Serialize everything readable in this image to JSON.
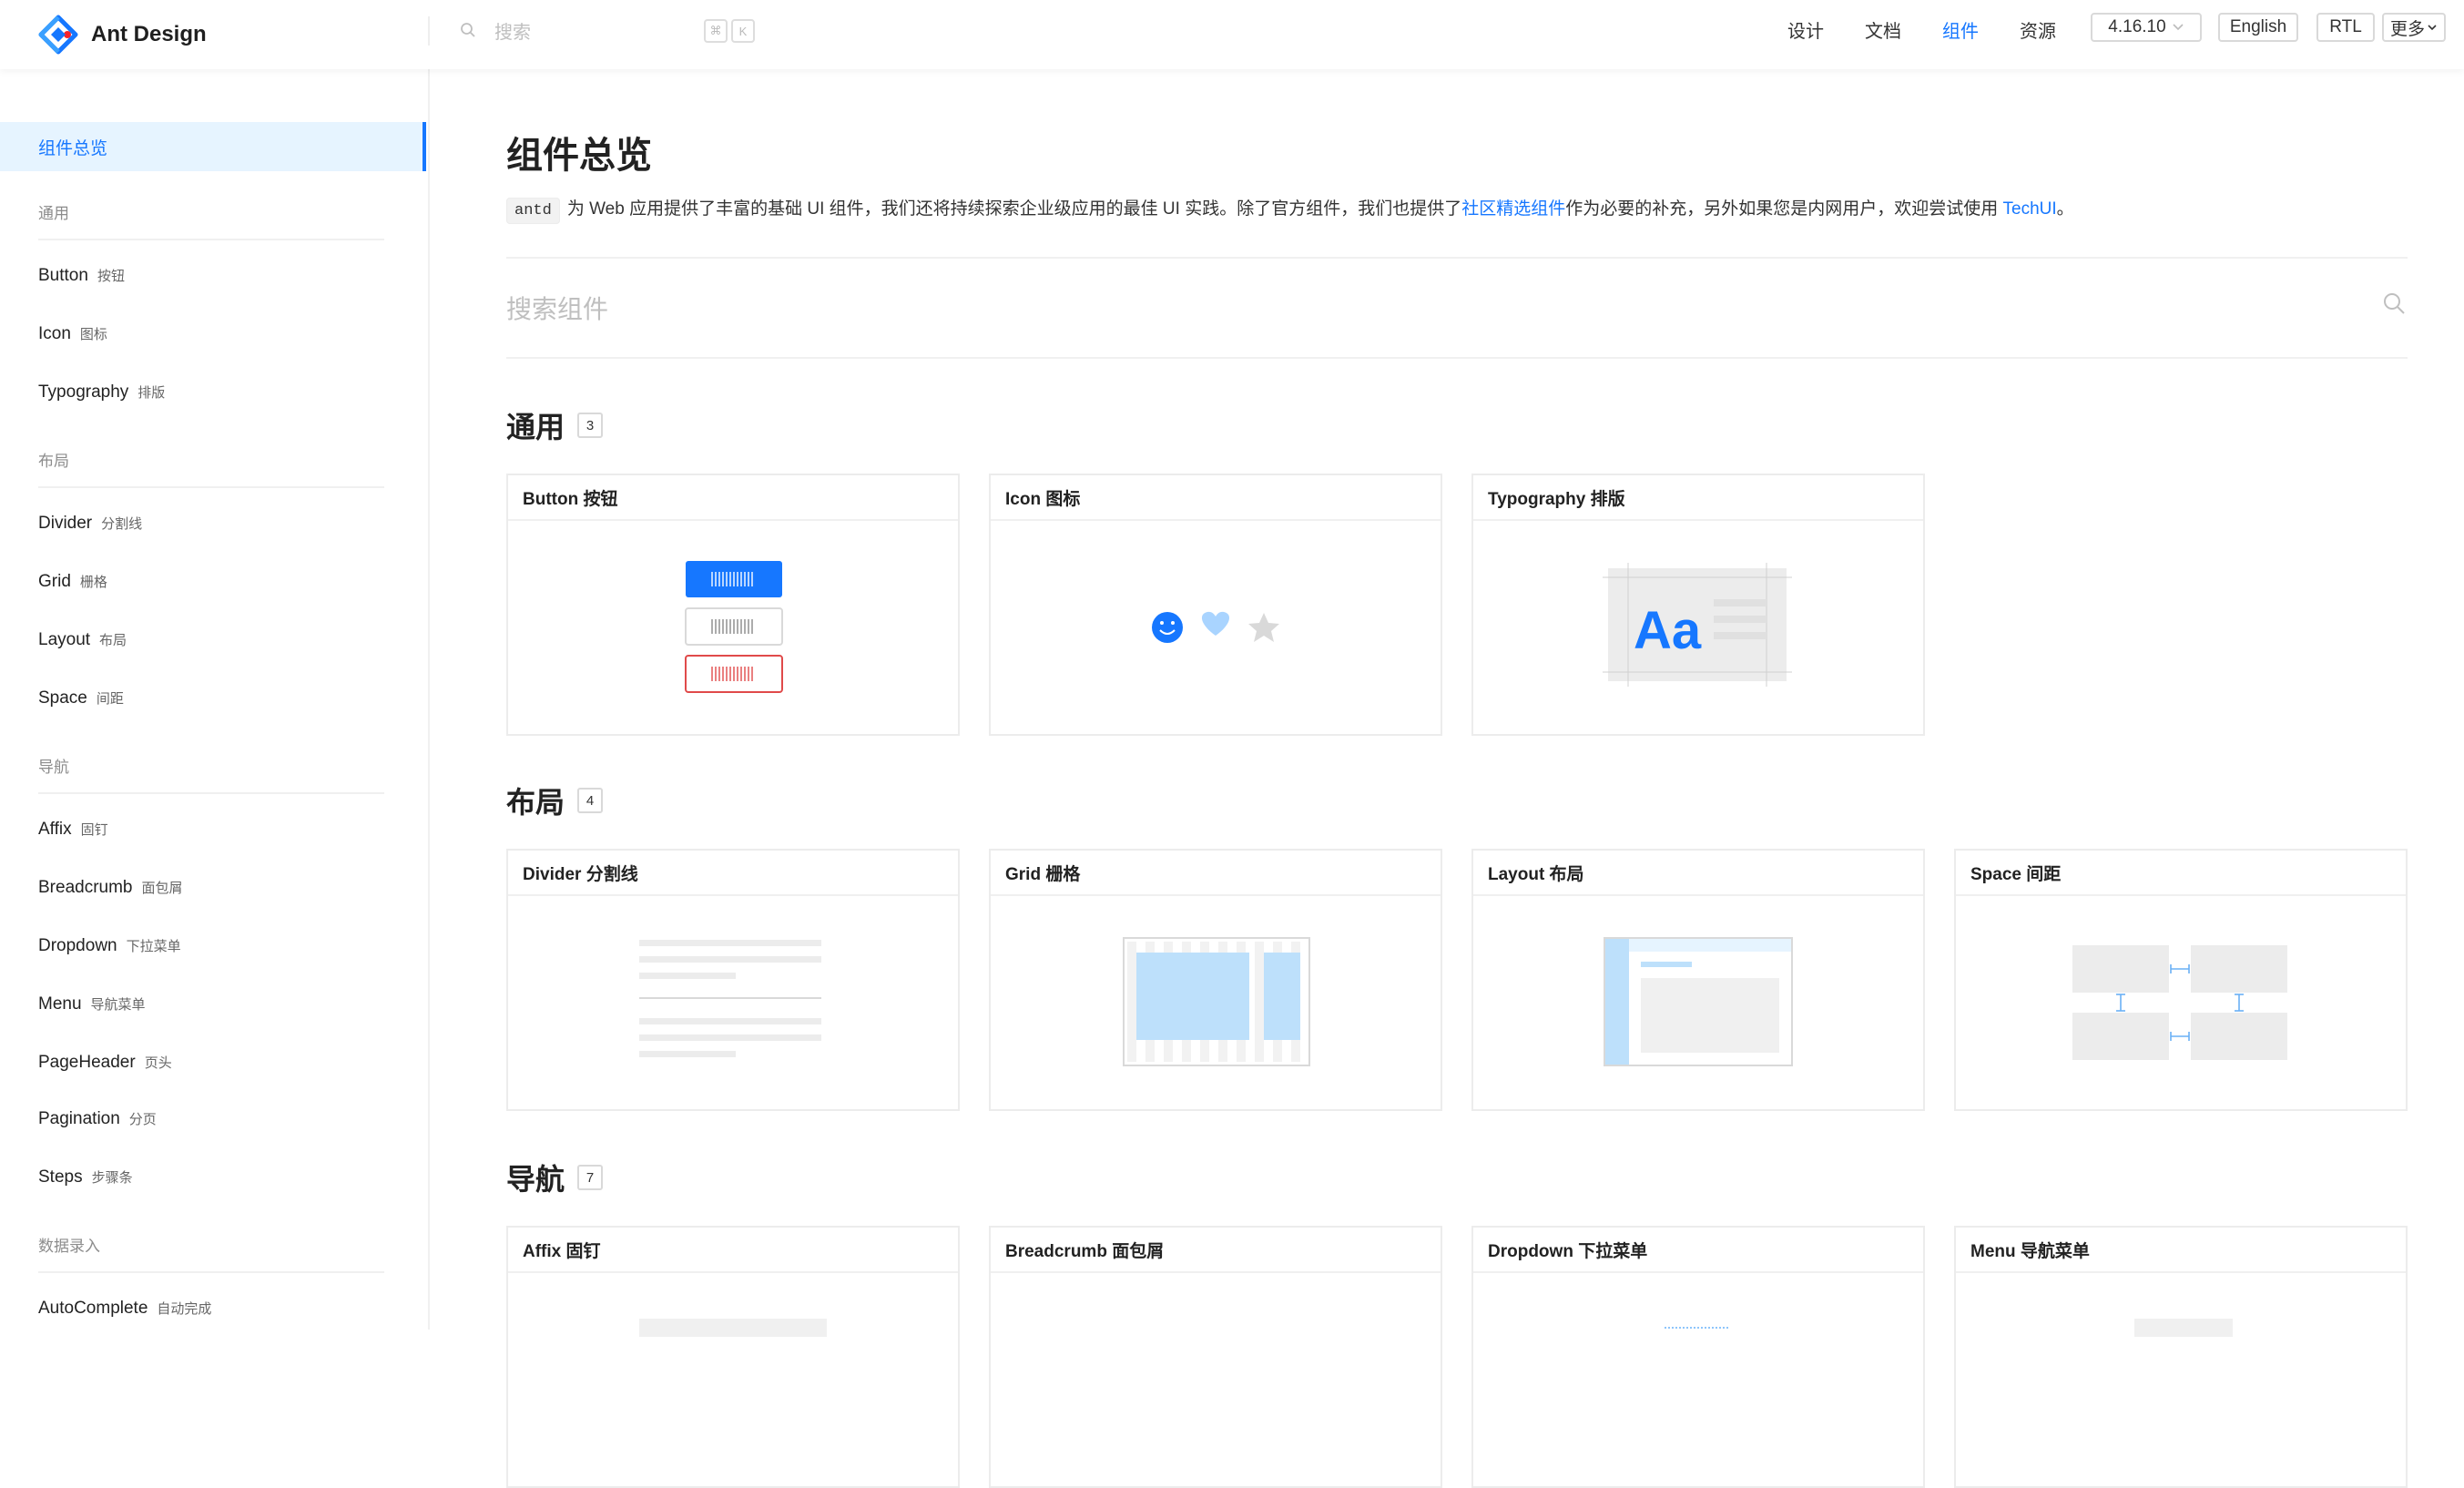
{
  "brand": {
    "name": "Ant Design",
    "logo_icon": "ant-design-logo-icon"
  },
  "header": {
    "search_placeholder": "搜索",
    "shortcut_keys": [
      "⌘",
      "K"
    ],
    "nav": [
      "设计",
      "文档",
      "组件",
      "资源"
    ],
    "active_nav": "组件",
    "version": "4.16.10",
    "lang_button": "English",
    "rtl_button": "RTL",
    "more_button": "更多"
  },
  "sidebar": {
    "active": "组件总览",
    "groups": [
      {
        "title": "通用",
        "items": [
          [
            "Button",
            "按钮"
          ],
          [
            "Icon",
            "图标"
          ],
          [
            "Typography",
            "排版"
          ]
        ]
      },
      {
        "title": "布局",
        "items": [
          [
            "Divider",
            "分割线"
          ],
          [
            "Grid",
            "栅格"
          ],
          [
            "Layout",
            "布局"
          ],
          [
            "Space",
            "间距"
          ]
        ]
      },
      {
        "title": "导航",
        "items": [
          [
            "Affix",
            "固钉"
          ],
          [
            "Breadcrumb",
            "面包屑"
          ],
          [
            "Dropdown",
            "下拉菜单"
          ],
          [
            "Menu",
            "导航菜单"
          ],
          [
            "PageHeader",
            "页头"
          ],
          [
            "Pagination",
            "分页"
          ],
          [
            "Steps",
            "步骤条"
          ]
        ]
      },
      {
        "title": "数据录入",
        "items": [
          [
            "AutoComplete",
            "自动完成"
          ]
        ]
      }
    ]
  },
  "main": {
    "title": "组件总览",
    "intro": {
      "code": "antd",
      "text1": "为 Web 应用提供了丰富的基础 UI 组件，我们还将持续探索企业级应用的最佳 UI 实践。除了官方组件，我们也提供了",
      "link1": "社区精选组件",
      "text2": "作为必要的补充，另外如果您是内网用户，欢迎尝试使用 ",
      "link2": "TechUI",
      "text3": "。"
    },
    "search_placeholder": "搜索组件",
    "sections": [
      {
        "title": "通用",
        "count": "3",
        "cards": [
          "Button 按钮",
          "Icon 图标",
          "Typography 排版"
        ]
      },
      {
        "title": "布局",
        "count": "4",
        "cards": [
          "Divider 分割线",
          "Grid 栅格",
          "Layout 布局",
          "Space 间距"
        ]
      },
      {
        "title": "导航",
        "count": "7",
        "cards": [
          "Affix 固钉",
          "Breadcrumb 面包屑",
          "Dropdown 下拉菜单",
          "Menu 导航菜单"
        ]
      }
    ]
  },
  "colors": {
    "primary": "#1677ff",
    "active_bg": "#e6f4ff",
    "border": "#f0f0f0",
    "danger": "#e04a4a"
  }
}
